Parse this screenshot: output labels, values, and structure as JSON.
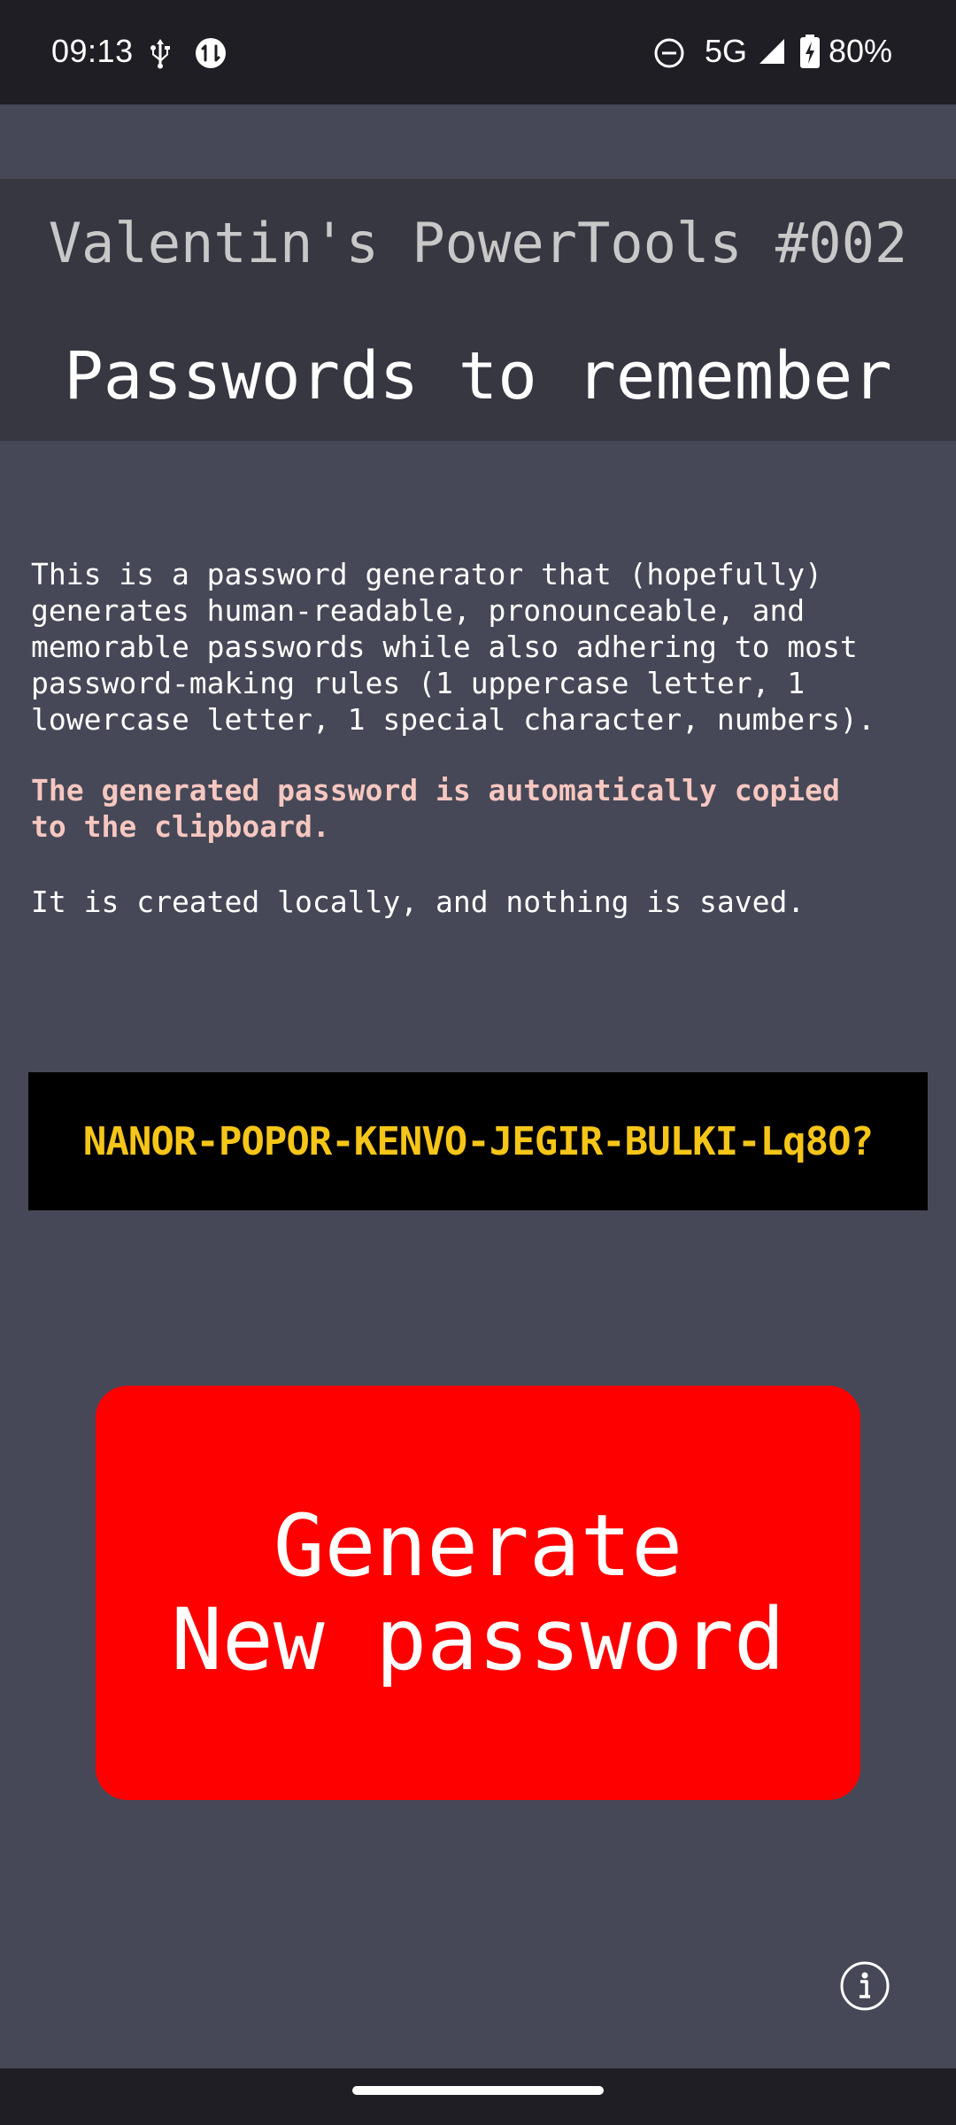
{
  "status_bar": {
    "time": "09:13",
    "network": "5G",
    "battery_percent": "80%",
    "icons": [
      "usb-icon",
      "app-notification-icon",
      "do-not-disturb-icon",
      "signal-icon",
      "battery-charging-icon"
    ]
  },
  "header": {
    "brand_title": "Valentin's PowerTools #002",
    "page_title": "Passwords to remember"
  },
  "description": {
    "intro": "This is a password generator that (hopefully)\ngenerates human-readable, pronounceable, and\nmemorable passwords while also adhering to most\npassword-making rules (1 uppercase letter, 1\nlowercase letter, 1 special character, numbers).",
    "warning": "The generated password is automatically copied\nto the clipboard.",
    "local_note": "It is created locally, and nothing is saved."
  },
  "password": {
    "value": "NANOR-POPOR-KENVO-JEGIR-BULKI-Lq8O?"
  },
  "generate_button": {
    "line1": "Generate",
    "line2": "New password"
  },
  "info_button": {
    "icon": "info-icon"
  },
  "colors": {
    "background": "#464857",
    "header_bg": "#373742",
    "warning_text": "#f6c7c0",
    "password_text": "#f5c518",
    "password_bg": "#000000",
    "button_bg": "#ff0000"
  }
}
